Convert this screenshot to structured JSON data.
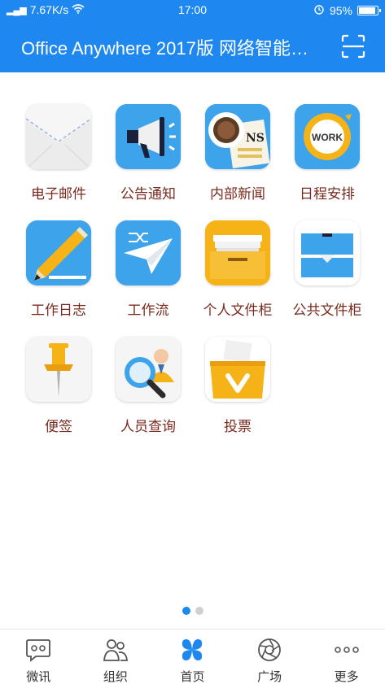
{
  "status_bar": {
    "signal": "5G",
    "net_speed": "7.67K/s",
    "time": "17:00",
    "battery": "95%",
    "battery_level": 0.95
  },
  "app_bar": {
    "title": "Office Anywhere 2017版 网络智能…",
    "scan_icon": "scan-icon"
  },
  "apps": [
    {
      "label": "电子邮件",
      "icon": "mail-icon"
    },
    {
      "label": "公告通知",
      "icon": "megaphone-icon"
    },
    {
      "label": "内部新闻",
      "icon": "news-icon"
    },
    {
      "label": "日程安排",
      "icon": "schedule-icon"
    },
    {
      "label": "工作日志",
      "icon": "journal-pencil-icon"
    },
    {
      "label": "工作流",
      "icon": "workflow-plane-icon"
    },
    {
      "label": "个人文件柜",
      "icon": "personal-cabinet-icon"
    },
    {
      "label": "公共文件柜",
      "icon": "public-cabinet-icon"
    },
    {
      "label": "便签",
      "icon": "pushpin-icon"
    },
    {
      "label": "人员查询",
      "icon": "person-search-icon"
    },
    {
      "label": "投票",
      "icon": "vote-box-icon"
    }
  ],
  "pager": {
    "pages": 2,
    "active": 1
  },
  "tabs": [
    {
      "label": "微讯",
      "icon": "chat-icon"
    },
    {
      "label": "组织",
      "icon": "people-icon"
    },
    {
      "label": "首页",
      "icon": "home-grid-icon",
      "active": true
    },
    {
      "label": "广场",
      "icon": "aperture-icon"
    },
    {
      "label": "更多",
      "icon": "more-icon"
    }
  ],
  "colors": {
    "primary": "#1e88f0",
    "label": "#7a2b1f"
  }
}
